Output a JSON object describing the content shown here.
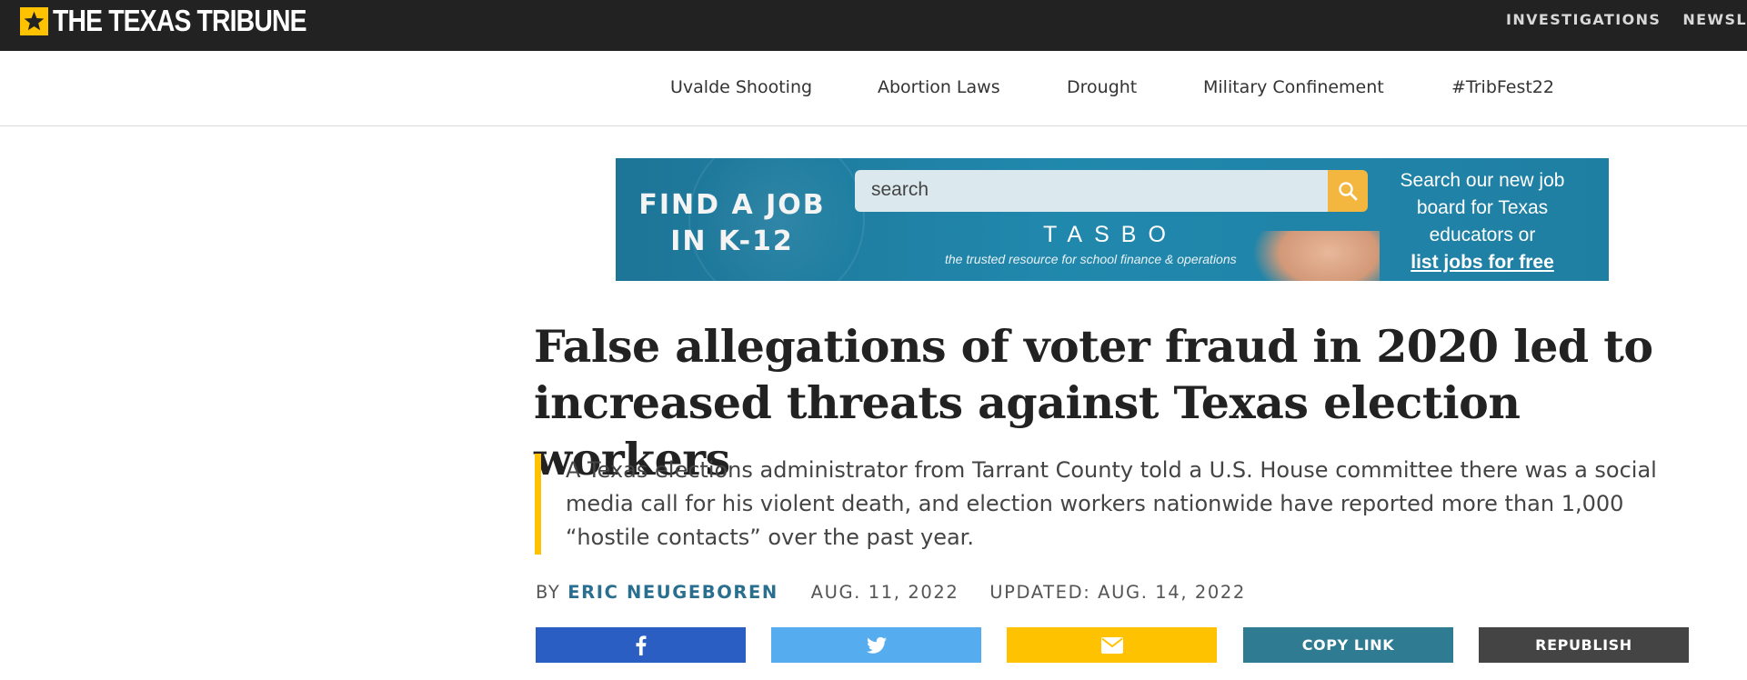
{
  "brand": {
    "name": "THE TEXAS TRIBUNE",
    "accent_color": "#ffc200",
    "header_bg": "#222222"
  },
  "top_nav": {
    "items": [
      "INVESTIGATIONS",
      "NEWSLETTERS"
    ]
  },
  "topic_nav": {
    "items": [
      "Uvalde Shooting",
      "Abortion Laws",
      "Drought",
      "Military Confinement",
      "#TribFest22"
    ]
  },
  "ad": {
    "headline_line1": "FIND A JOB",
    "headline_line2": "IN K-12",
    "search_placeholder": "search",
    "brand": "TASBO",
    "tagline": "the trusted resource for school finance & operations",
    "right_line1": "Search our new job",
    "right_line2": "board for Texas",
    "right_line3": "educators or",
    "right_link": "list jobs for free",
    "icons": [
      "search-icon"
    ]
  },
  "article": {
    "headline": "False allegations of voter fraud in 2020 led to increased threats against Texas election workers",
    "summary": "A Texas elections administrator from Tarrant County told a U.S. House committee there was a social media call for his violent death, and election workers nationwide have reported more than 1,000 “hostile contacts” over the past year.",
    "byline_prefix": "BY",
    "author": "ERIC NEUGEBOREN",
    "date": "AUG. 11, 2022",
    "updated": "UPDATED: AUG. 14, 2022"
  },
  "share": {
    "facebook_icon": "facebook-icon",
    "twitter_icon": "twitter-icon",
    "email_icon": "envelope-icon",
    "copy_link": "COPY LINK",
    "republish": "REPUBLISH",
    "colors": {
      "facebook": "#2b5ec2",
      "twitter": "#55acee",
      "email": "#ffc200",
      "copy_link": "#2f7c92",
      "republish": "#444444"
    }
  }
}
